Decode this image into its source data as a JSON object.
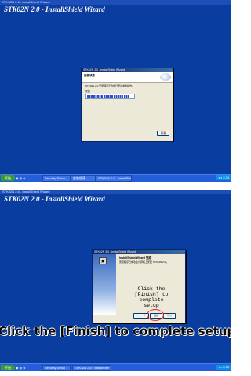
{
  "screens": [
    {
      "caption": "STK02N 2.0 - InstallShield Wizard",
      "desktop_title": "STK02N 2.0 - InstallShield Wizard",
      "dialog": {
        "title": "STK02N 2.0 - InstallShield Wizard",
        "header_title": "安装状态",
        "header_subtitle": "",
        "status_text": "STK02N 2.0 安装程序正在执行所请求的操作。",
        "progress_label": "安装",
        "progress": 0.9,
        "cancel_label": "取消"
      },
      "taskbar": {
        "start_label": "开始",
        "quick_icons": "◉ ◍ ◈",
        "buttons": [
          "Security Setup",
          "安装程序",
          "STK02N 2.0 - InstallShie"
        ],
        "tray_text": "◐◑ 2:34"
      }
    },
    {
      "caption": "STK02N 2.0 - InstallShield Wizard",
      "desktop_title": "STK02N 2.0 - InstallShield Wizard",
      "dialog": {
        "title": "STK02N 2.0 - InstallShield Wizard",
        "finish_heading": "InstallShield Wizard 完成",
        "finish_text": "安装程序已成功在计算机上安装 STK02N 2.0 。",
        "back_label": "< 上一步",
        "finish_label": "完成",
        "cancel_label": "取消"
      },
      "callout_text": "Click the [Finish] to complete setup",
      "banner_text": "Click the [Finish] to complete setup",
      "taskbar": {
        "start_label": "开始",
        "quick_icons": "◉ ◍ ◈",
        "buttons": [
          "Security Setup",
          "STK02N 2.0 - InstallShie"
        ],
        "tray_text": "◐◑ 2:35"
      }
    }
  ],
  "colors": {
    "desktop": "#0a3da0",
    "highlight_circle": "#ff1a1a"
  }
}
